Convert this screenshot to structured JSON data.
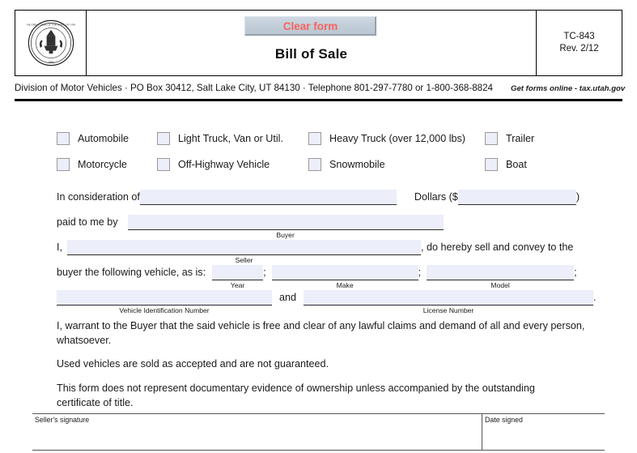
{
  "header": {
    "seal_icon": "utah-state-seal",
    "agency": "Utah State Tax Commission",
    "title": "Bill of Sale",
    "clear_button": "Clear form",
    "form_number": "TC-843",
    "revision": "Rev. 2/12"
  },
  "division": {
    "contact_line": "Division of Motor Vehicles · PO Box 30412, Salt Lake City, UT 84130 · Telephone 801-297-7780 or 1-800-368-8824",
    "get_forms": "Get forms online - tax.utah.gov"
  },
  "vehicle_types": [
    [
      {
        "label": "Automobile",
        "checked": false
      },
      {
        "label": "Light Truck, Van or Util.",
        "checked": false
      },
      {
        "label": "Heavy Truck (over 12,000 lbs)",
        "checked": false
      },
      {
        "label": "Trailer",
        "checked": false
      }
    ],
    [
      {
        "label": "Motorcycle",
        "checked": false
      },
      {
        "label": "Off-Highway Vehicle",
        "checked": false
      },
      {
        "label": "Snowmobile",
        "checked": false
      },
      {
        "label": "Boat",
        "checked": false
      }
    ]
  ],
  "consideration": {
    "lead_text": "In consideration of",
    "amount_words_value": "",
    "dollars_label": "Dollars ($",
    "amount_value": "",
    "close_paren": ")"
  },
  "paid_by": {
    "lead_text": "paid to me by",
    "value": "",
    "caption": "Buyer"
  },
  "seller": {
    "lead_text": "I,",
    "value": "",
    "caption": "Seller",
    "trail_text": ", do hereby sell and convey to the"
  },
  "vehicle": {
    "lead_text": "buyer the following vehicle, as is:",
    "year_value": "",
    "year_caption": "Year",
    "sep1": ";",
    "make_value": "",
    "make_caption": "Make",
    "sep2": ";",
    "model_value": "",
    "model_caption": "Model",
    "sep3": ";"
  },
  "identifiers": {
    "vin_value": "",
    "vin_caption": "Vehicle Identification Number",
    "and_text": "and",
    "license_value": "",
    "license_caption": "License Number",
    "period": "."
  },
  "paragraphs": {
    "warranty": "I, warrant to the Buyer that the said vehicle is free and clear of any lawful claims and demand of all and every person, whatsoever.",
    "used": "Used vehicles are sold as accepted and are not guaranteed.",
    "notice": "This form does not represent documentary evidence of ownership unless accompanied by the outstanding certificate of title."
  },
  "signature": {
    "seller_caption": "Seller's signature",
    "seller_value": "",
    "date_caption": "Date signed",
    "date_value": ""
  },
  "colors": {
    "field_fill": "#eceefa",
    "clear_button_text": "#f9635e",
    "clear_button_bg": "#c2ced9",
    "rule": "#000000"
  }
}
